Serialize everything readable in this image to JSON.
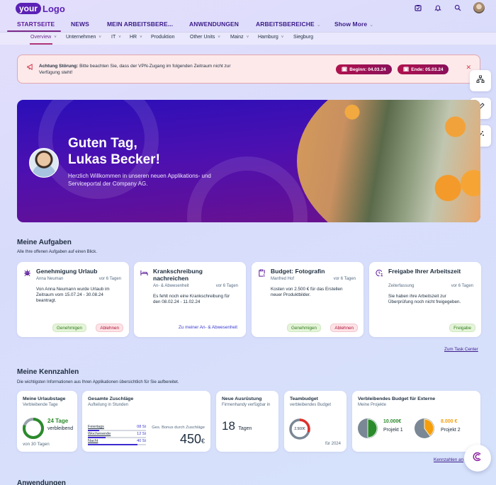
{
  "logo": {
    "part1": "your",
    "part2": "Logo"
  },
  "top_icons": [
    "tasks-icon",
    "bell-icon",
    "search-icon",
    "user-avatar"
  ],
  "main_nav": [
    {
      "label": "STARTSEITE",
      "active": true,
      "chevron": false
    },
    {
      "label": "NEWS",
      "chevron": false
    },
    {
      "label": "MEIN ARBEITSBERE...",
      "chevron": false
    },
    {
      "label": "ANWENDUNGEN",
      "chevron": false
    },
    {
      "label": "ARBEITSBEREICHE",
      "chevron": true
    },
    {
      "label": "Show More",
      "chevron": true
    }
  ],
  "sub_nav": [
    {
      "label": "Overview",
      "active": true,
      "chevron": true
    },
    {
      "label": "Unternehmen",
      "chevron": true
    },
    {
      "label": "IT",
      "chevron": true
    },
    {
      "label": "HR",
      "chevron": true
    },
    {
      "label": "Produktion",
      "chevron": false
    },
    {
      "label": "Other Units",
      "chevron": true
    },
    {
      "label": "Mainz",
      "chevron": true
    },
    {
      "label": "Hamburg",
      "chevron": true
    },
    {
      "label": "Siegburg",
      "chevron": false
    }
  ],
  "alert": {
    "title": "Achtung Störung:",
    "text": "Bitte beachten Sie, dass der VPN-Zugang im folgenden Zeitraum nicht zur Verfügung steht!",
    "start": "Beginn: 04.03.24",
    "end": "Ende: 05.03.24"
  },
  "hero": {
    "greeting_line1": "Guten Tag,",
    "greeting_line2": "Lukas Becker!",
    "subtitle": "Herzlich Willkommen in unseren neuen Applikations- und Serviceportal der Company AG."
  },
  "tasks_section": {
    "title": "Meine Aufgaben",
    "subtitle": "Alle Ihre offenen Aufgaben auf einen Blick.",
    "link": "Zum Task Center",
    "cards": [
      {
        "icon": "bug-icon",
        "title": "Genehmigung Urlaub",
        "meta_left": "Anna Neuman",
        "meta_right": "vor 6 Tagen",
        "body": "Von Anna Neumann wurde Urlaub im Zeitraum vom 15.07.24 - 30.08.24 beantragt.",
        "approve": "Genehmigen",
        "reject": "Ablehnen"
      },
      {
        "icon": "bed-icon",
        "title": "Krankschreibung nachreichen",
        "meta_left": "An- & Abwesenheit",
        "meta_right": "vor 6 Tagen",
        "body": "Es fehlt noch eine Krankschreibung für den 08.02.24 - 11.02.24",
        "link": "Zu meiner An- & Abwesenheit"
      },
      {
        "icon": "clipboard-dollar-icon",
        "title": "Budget: Fotografin",
        "meta_left": "Manfred Hof",
        "meta_right": "vor 6 Tagen",
        "body": "Kosten von 2.500 € für das Erstellen neuer Produktbilder.",
        "approve": "Genehmigen",
        "reject": "Ablehnen"
      },
      {
        "icon": "clock-user-icon",
        "title": "Freigabe Ihrer Arbeitszeit",
        "meta_left": "Zeiterfassung",
        "meta_right": "vor 6 Tagen",
        "body": "Sie haben ihre Arbeitszeit zur Überprüfung noch nicht freigegeben.",
        "approve": "Freigabe"
      }
    ]
  },
  "kpi_section": {
    "title": "Meine Kennzahlen",
    "subtitle": "Die wichtigsten Informationen aus Ihren Applikationen übersichtlich für Sie aufbereitet.",
    "link": "Kennzahlen an",
    "vacation": {
      "title": "Meine Urlaubstage",
      "subtitle": "Verbleibende Tage",
      "value": "24 Tage",
      "value_label": "verbleibend",
      "total": "von 30 Tagen",
      "fraction": 0.8,
      "color": "#2b8a2b"
    },
    "surcharges": {
      "title": "Gesamte Zuschläge",
      "subtitle": "Aufteilung in Stunden",
      "rows": [
        {
          "label": "Feiertags",
          "value": "08 St",
          "fraction": 0.2
        },
        {
          "label": "Wochenende",
          "value": "12 St",
          "fraction": 0.3
        },
        {
          "label": "Nacht",
          "value": "40 St",
          "fraction": 0.85
        }
      ],
      "bonus_label": "Ges. Bonus durch Zuschläge",
      "bonus_value": "450",
      "bonus_unit": "€"
    },
    "equipment": {
      "title": "Neue Ausrüstung",
      "subtitle": "Firmenhandy verfügbar in",
      "value": "18",
      "unit": "Tagen"
    },
    "teambudget": {
      "title": "Teambudget",
      "subtitle": "verbleibendes Budget",
      "value": "2.500€",
      "footer": "für 2024",
      "fraction": 0.3,
      "color": "#e0302a"
    },
    "external": {
      "title": "Verbleibendes Budget für Externe",
      "subtitle": "Meine Projekte",
      "projects": [
        {
          "amount": "10.000€",
          "name": "Projekt 1",
          "color": "#2b8a2b",
          "fraction": 0.5
        },
        {
          "amount": "8.000 €",
          "name": "Projekt 2",
          "color": "#f59e0b",
          "fraction": 0.4
        }
      ]
    }
  },
  "apps_section": {
    "title": "Anwendungen"
  }
}
